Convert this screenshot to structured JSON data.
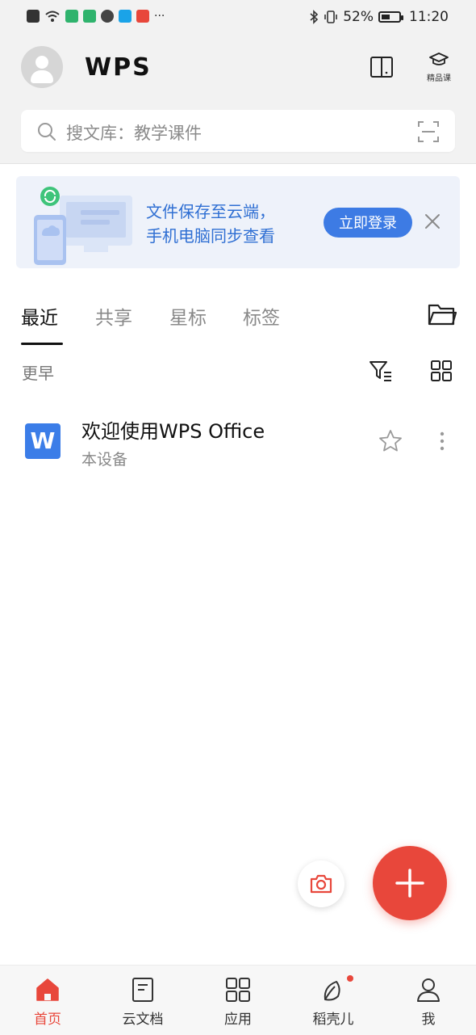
{
  "status_bar": {
    "battery": "52%",
    "battery_level": 0.52,
    "time": "11:20",
    "more": "···"
  },
  "header": {
    "logo": "WPS",
    "course_label": "精品课"
  },
  "search": {
    "placeholder": "搜文库：教学课件"
  },
  "banner": {
    "line1": "文件保存至云端，",
    "line2": "手机电脑同步查看",
    "login_label": "立即登录"
  },
  "tabs": [
    {
      "label": "最近",
      "active": true
    },
    {
      "label": "共享",
      "active": false
    },
    {
      "label": "星标",
      "active": false
    },
    {
      "label": "标签",
      "active": false
    }
  ],
  "section_label": "更早",
  "files": [
    {
      "name": "欢迎使用WPS Office",
      "location": "本设备",
      "icon_letter": "W"
    }
  ],
  "bottom_nav": [
    {
      "label": "首页",
      "icon": "home-icon",
      "active": true
    },
    {
      "label": "云文档",
      "icon": "cloud-doc-icon",
      "active": false
    },
    {
      "label": "应用",
      "icon": "apps-grid-icon",
      "active": false
    },
    {
      "label": "稻壳儿",
      "icon": "leaf-icon",
      "active": false
    },
    {
      "label": "我",
      "icon": "profile-icon",
      "active": false
    }
  ],
  "colors": {
    "accent_red": "#e8473b",
    "accent_blue": "#3d7be4",
    "word_blue": "#3b7de8"
  }
}
